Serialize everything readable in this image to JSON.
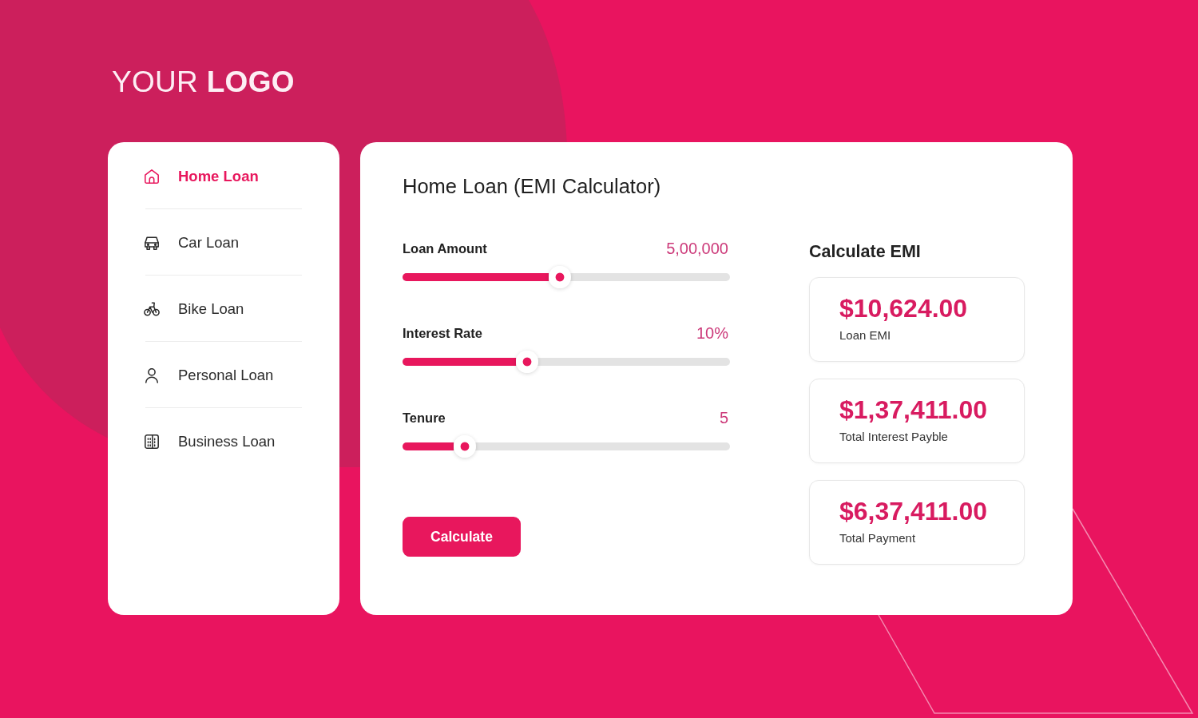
{
  "logo": {
    "text": "YOUR **LOGO**"
  },
  "sidebar": {
    "items": [
      {
        "label": "Home Loan",
        "selected": true
      },
      {
        "label": "Car Loan",
        "selected": false
      },
      {
        "label": "Bike Loan",
        "selected": false
      },
      {
        "label": "Personal Loan",
        "selected": false
      },
      {
        "label": "Business Loan",
        "selected": false
      }
    ]
  },
  "calculator": {
    "title": "Home Loan (EMI Calculator)",
    "sliders": [
      {
        "label": "Loan Amount",
        "value": "5,00,000",
        "level": 0.48
      },
      {
        "label": "Interest Rate",
        "value": "10%",
        "level": 0.38
      },
      {
        "label": "Tenure",
        "value": "5",
        "level": 0.19
      }
    ],
    "button": {
      "label": "Calculate"
    }
  },
  "results": {
    "title": "Calculate EMI",
    "cards": [
      {
        "amount": "$10,624.00",
        "label": "Loan EMI"
      },
      {
        "amount": "$1,37,411.00",
        "label": "Total Interest Payble"
      },
      {
        "amount": "$6,37,411.00",
        "label": "Total Payment"
      }
    ]
  }
}
